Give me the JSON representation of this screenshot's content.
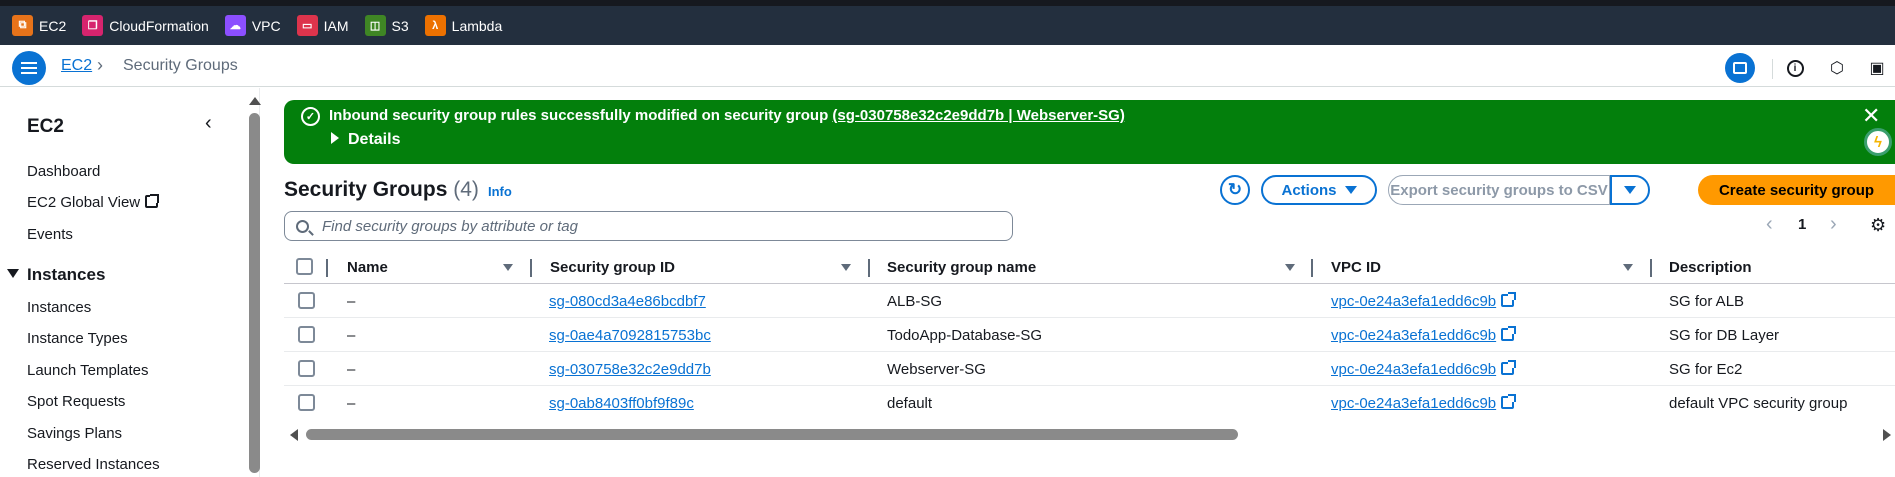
{
  "favorites": [
    {
      "label": "EC2",
      "icon": "ec2-icon",
      "color": "#e7731a"
    },
    {
      "label": "CloudFormation",
      "icon": "cloudformation-icon",
      "color": "#d6246e"
    },
    {
      "label": "VPC",
      "icon": "vpc-icon",
      "color": "#8c4fff"
    },
    {
      "label": "IAM",
      "icon": "iam-icon",
      "color": "#dd344c"
    },
    {
      "label": "S3",
      "icon": "s3-icon",
      "color": "#3f8624"
    },
    {
      "label": "Lambda",
      "icon": "lambda-icon",
      "color": "#ed7100"
    }
  ],
  "breadcrumb": {
    "root": "EC2",
    "current": "Security Groups"
  },
  "sidenav": {
    "title": "EC2",
    "links_top": [
      "Dashboard",
      "EC2 Global View",
      "Events"
    ],
    "section": "Instances",
    "section_links": [
      "Instances",
      "Instance Types",
      "Launch Templates",
      "Spot Requests",
      "Savings Plans",
      "Reserved Instances"
    ]
  },
  "flash": {
    "message": "Inbound security group rules successfully modified on security group",
    "link": "(sg-030758e32c2e9dd7b | Webserver-SG)",
    "details": "Details"
  },
  "header": {
    "title": "Security Groups",
    "count": "(4)",
    "info": "Info",
    "actions": "Actions",
    "export": "Export security groups to CSV",
    "create": "Create security group"
  },
  "search": {
    "placeholder": "Find security groups by attribute or tag",
    "value": ""
  },
  "pagination": {
    "page": "1"
  },
  "table": {
    "columns": [
      "Name",
      "Security group ID",
      "Security group name",
      "VPC ID",
      "Description"
    ],
    "rows": [
      {
        "name": "–",
        "id": "sg-080cd3a4e86bcdbf7",
        "group_name": "ALB-SG",
        "vpc": "vpc-0e24a3efa1edd6c9b",
        "description": "SG for ALB"
      },
      {
        "name": "–",
        "id": "sg-0ae4a7092815753bc",
        "group_name": "TodoApp-Database-SG",
        "vpc": "vpc-0e24a3efa1edd6c9b",
        "description": "SG for DB Layer"
      },
      {
        "name": "–",
        "id": "sg-030758e32c2e9dd7b",
        "group_name": "Webserver-SG",
        "vpc": "vpc-0e24a3efa1edd6c9b",
        "description": "SG for Ec2"
      },
      {
        "name": "–",
        "id": "sg-0ab8403ff0bf9f89c",
        "group_name": "default",
        "vpc": "vpc-0e24a3efa1edd6c9b",
        "description": "default VPC security group"
      }
    ]
  },
  "colors": {
    "link": "#0972d3",
    "success": "#037f0c",
    "primary": "#ff9900",
    "topbar": "#232f3e"
  }
}
